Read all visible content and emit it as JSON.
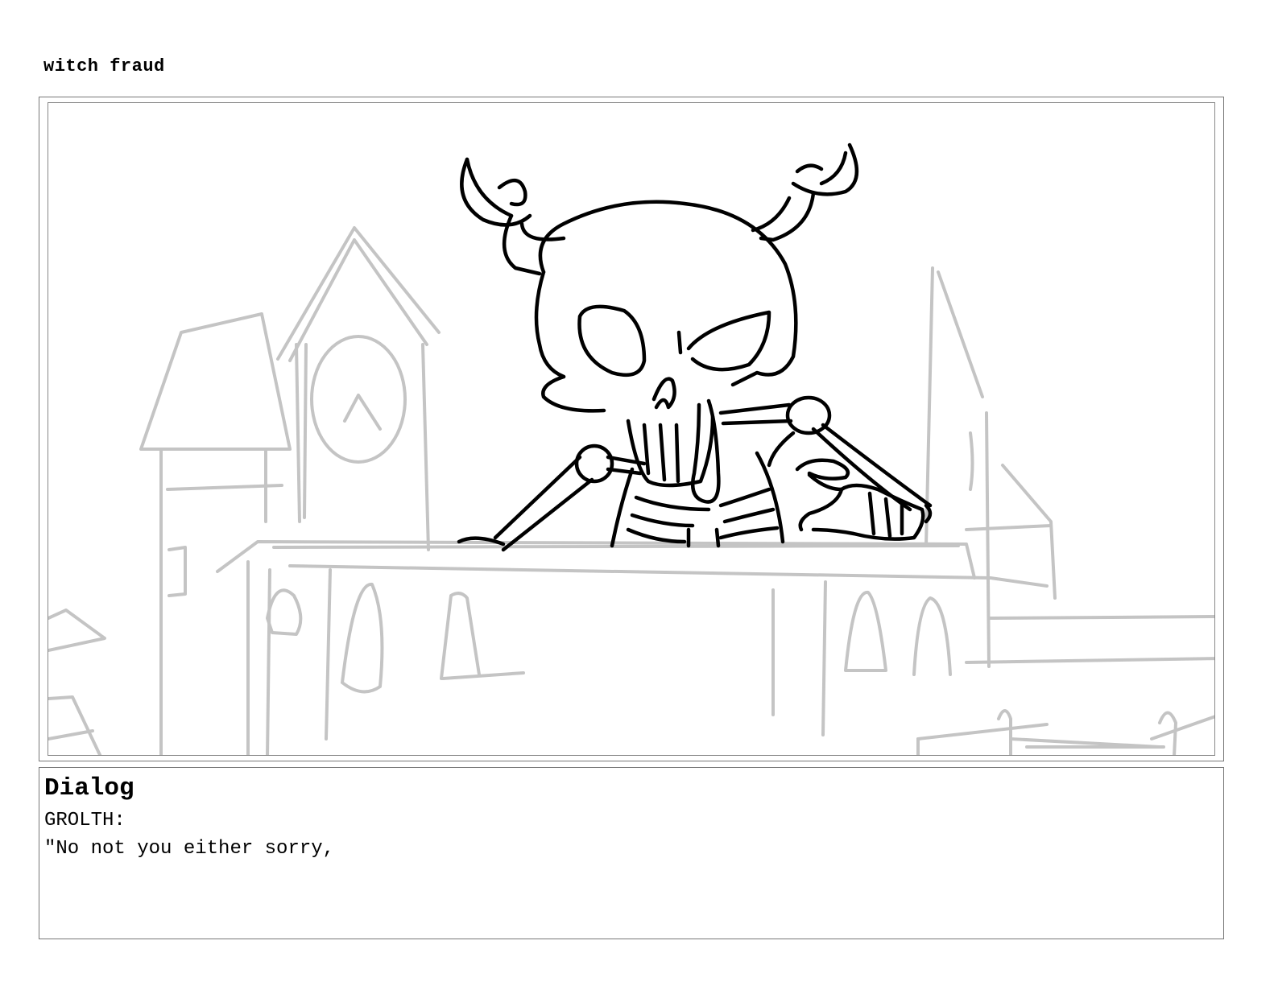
{
  "document": {
    "title": "witch fraud"
  },
  "panel": {
    "sketch": "storyboard-sketch"
  },
  "dialog": {
    "heading": "Dialog",
    "speaker": "GROLTH:",
    "line": "\"No not you either sorry,"
  },
  "colors": {
    "border": "#777777",
    "background_sketch": "#c4c4c4",
    "ink": "#000000"
  }
}
